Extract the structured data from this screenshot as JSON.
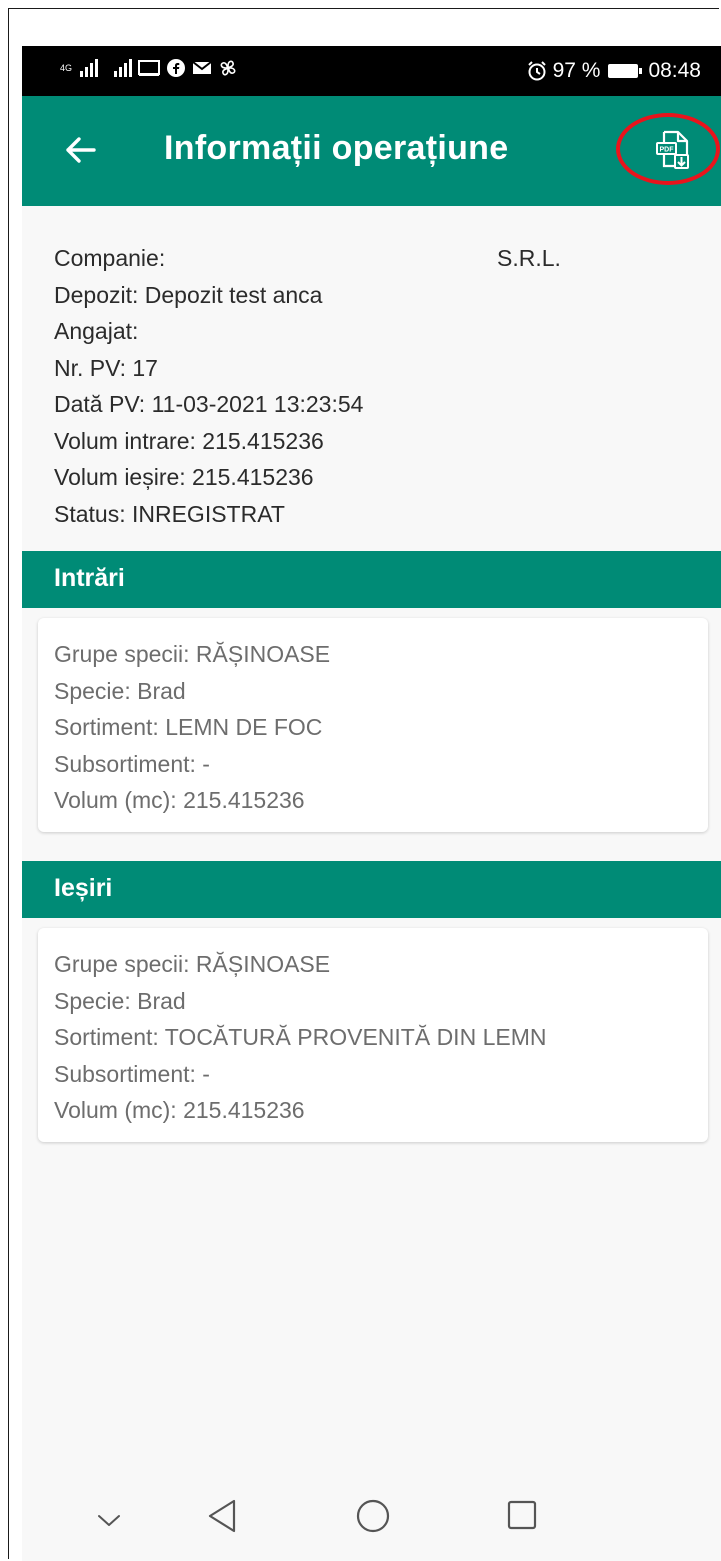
{
  "status_bar": {
    "network": "4G",
    "status_icons": [
      "cast-icon",
      "facebook-icon",
      "mail-icon",
      "fan-icon"
    ],
    "alarm_icon": "alarm-icon",
    "battery_text": "97 %",
    "time": "08:48"
  },
  "toolbar": {
    "title": "Informații operațiune",
    "back_icon": "back-arrow-icon",
    "pdf_icon": "pdf-download-icon",
    "pdf_badge": "PDF",
    "highlight_color": "#e8141c"
  },
  "info": {
    "company": "Companie:",
    "company_suffix": "S.R.L.",
    "depot": "Depozit: Depozit test anca",
    "employee": "Angajat:",
    "pv_number": "Nr. PV: 17",
    "pv_date": "Dată PV: 11-03-2021 13:23:54",
    "volume_in": "Volum intrare: 215.415236",
    "volume_out": "Volum ieșire: 215.415236",
    "status": "Status: INREGISTRAT"
  },
  "sections": {
    "inputs": {
      "title": "Intrări",
      "card": {
        "species_group": "Grupe specii: RĂȘINOASE",
        "species": "Specie: Brad",
        "assortment": "Sortiment: LEMN DE FOC",
        "sub_assortment": "Subsortiment: -",
        "volume": "Volum (mc): 215.415236"
      }
    },
    "outputs": {
      "title": "Ieșiri",
      "card": {
        "species_group": "Grupe specii: RĂȘINOASE",
        "species": "Specie: Brad",
        "assortment": "Sortiment: TOCĂTURĂ PROVENITĂ DIN LEMN",
        "sub_assortment": "Subsortiment: -",
        "volume": "Volum (mc): 215.415236"
      }
    }
  },
  "navbar": {
    "items": [
      "chevron-down-icon",
      "back-triangle-icon",
      "home-circle-icon",
      "recents-square-icon"
    ]
  },
  "colors": {
    "accent": "#008b76",
    "status_bar": "#000000",
    "background": "#f8f8f8"
  }
}
